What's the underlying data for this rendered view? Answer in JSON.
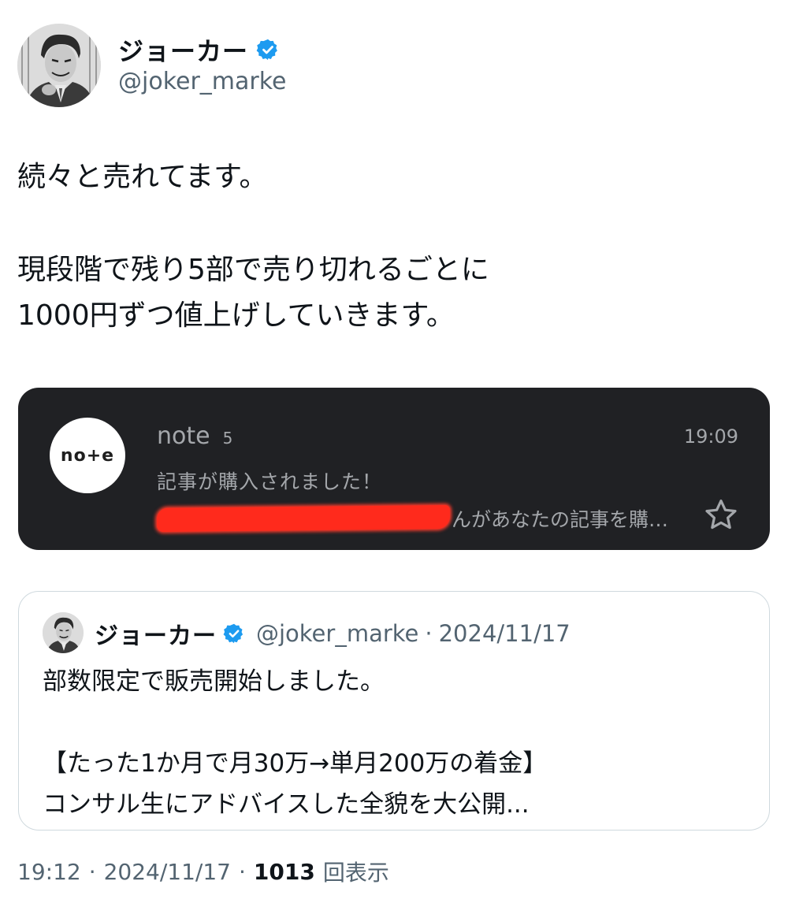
{
  "author": {
    "display_name": "ジョーカー",
    "handle": "@joker_marke",
    "verified_icon": "verified-badge-icon",
    "badge_color": "#1d9bf0"
  },
  "tweet": {
    "lines": [
      "続々と売れてます。",
      "",
      "現段階で残り5部で売り切れるごとに",
      "1000円ずつ値上げしていきます。"
    ]
  },
  "notification": {
    "app_icon_text": "no+e",
    "app_name": "note",
    "count": "5",
    "time": "19:09",
    "title": "記事が購入されました！",
    "body_visible": "んがあなたの記事を購…",
    "star_icon": "star-outline-icon",
    "redaction_color": "#ff2a1c",
    "background_color": "#202124"
  },
  "quote": {
    "display_name": "ジョーカー",
    "handle": "@joker_marke",
    "separator": "·",
    "date": "2024/11/17",
    "lines": [
      "部数限定で販売開始しました。",
      "",
      "【たった1か月で月30万→単月200万の着金】",
      "コンサル生にアドバイスした全貌を大公開..."
    ]
  },
  "meta": {
    "time": "19:12",
    "sep1": "·",
    "date": "2024/11/17",
    "sep2": "·",
    "views_count": "1013",
    "views_label": "回表示"
  }
}
